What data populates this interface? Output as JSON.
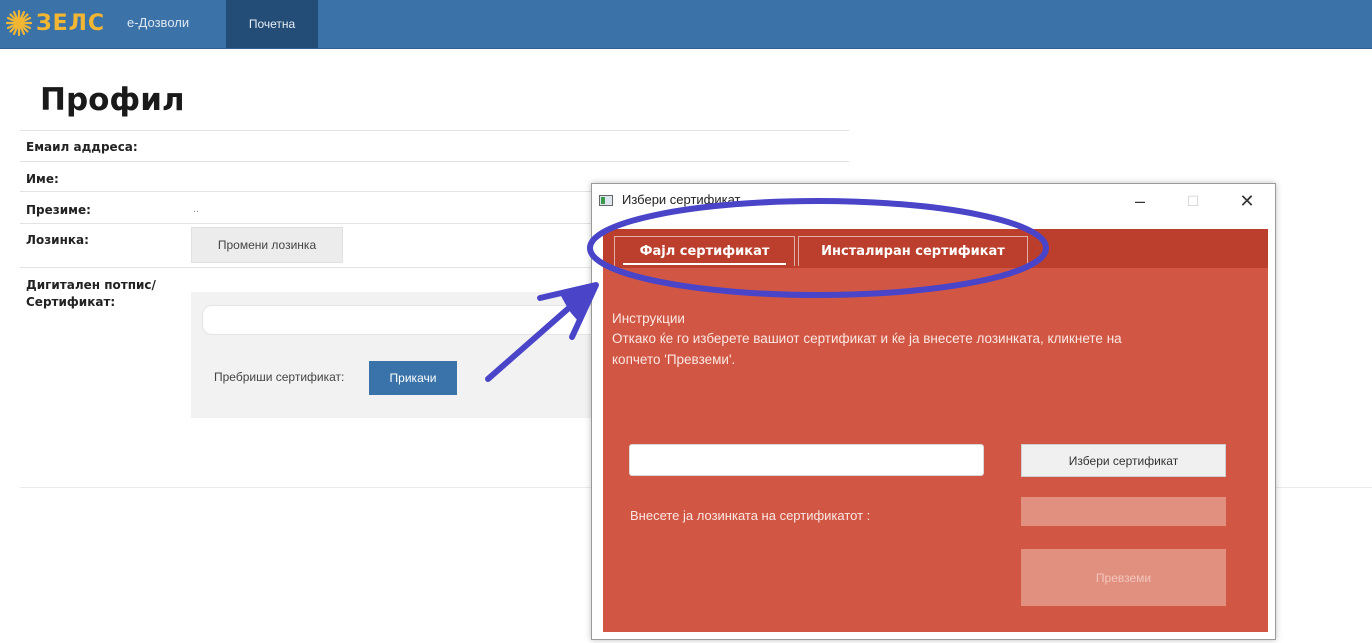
{
  "nav": {
    "logo_text": "ЗЕЛС",
    "app_name": "е-Дозволи",
    "tab_home": "Почетна"
  },
  "profile": {
    "title": "Профил",
    "email_label": "Емаил аддреса:",
    "name_label": "Име:",
    "surname_label": "Презиме:",
    "surname_value": "..",
    "password_label": "Лозинка:",
    "change_password_button": "Промени лозинка",
    "signature_label_line1": "Дигитален потпис/",
    "signature_label_line2": "Сертификат:",
    "upload_label": "Пребриши сертификат:",
    "attach_button": "Прикачи"
  },
  "dialog": {
    "title": "Избери сертификат",
    "tabs": [
      "Фајл сертификат",
      "Инсталиран сертификат"
    ],
    "instructions_title": "Инструкции",
    "instructions_line1": "Откако ќе го изберете вашиот сертификат и ќе ја внесете лозинката, кликнете на",
    "instructions_line2": "копчето 'Превземи'.",
    "choose_button": "Избери сертификат",
    "password_label": "Внесете ја лозинката на сертификатот :",
    "download_button": "Превземи"
  },
  "colors": {
    "nav_bar": "#3b72a8",
    "nav_active_tab": "#234d76",
    "dialog_body": "#d15744",
    "dialog_tabstrip": "#bc3f2d",
    "annotation": "#4a45c8",
    "primary_button": "#3a73a9"
  },
  "icons": {
    "logo": "sun-logo-icon",
    "window": "window-app-icon",
    "minimize": "minimize-icon",
    "maximize": "maximize-icon",
    "close": "close-icon",
    "annotation_ellipse": "highlight-ellipse",
    "annotation_arrow": "pointer-arrow"
  }
}
